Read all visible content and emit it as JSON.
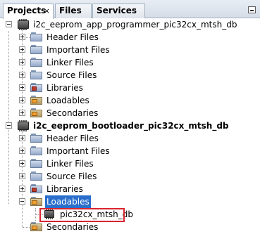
{
  "tabs": [
    {
      "label": "Projects",
      "active": true
    },
    {
      "label": "Files",
      "active": false
    },
    {
      "label": "Services",
      "active": false
    }
  ],
  "close_glyph": "×",
  "tree": {
    "project1": {
      "name": "i2c_eeprom_app_programmer_pic32cx_mtsh_db",
      "children": [
        "Header Files",
        "Important Files",
        "Linker Files",
        "Source Files",
        "Libraries",
        "Loadables",
        "Secondaries"
      ]
    },
    "project2": {
      "name": "i2c_eeprom_bootloader_pic32cx_mtsh_db",
      "children": [
        "Header Files",
        "Important Files",
        "Linker Files",
        "Source Files",
        "Libraries",
        "Loadables",
        "Secondaries"
      ],
      "loadables_child": "pic32cx_mtsh_db"
    }
  },
  "colors": {
    "selection": "#2a6fcc",
    "highlight_box": "#d7262f"
  }
}
